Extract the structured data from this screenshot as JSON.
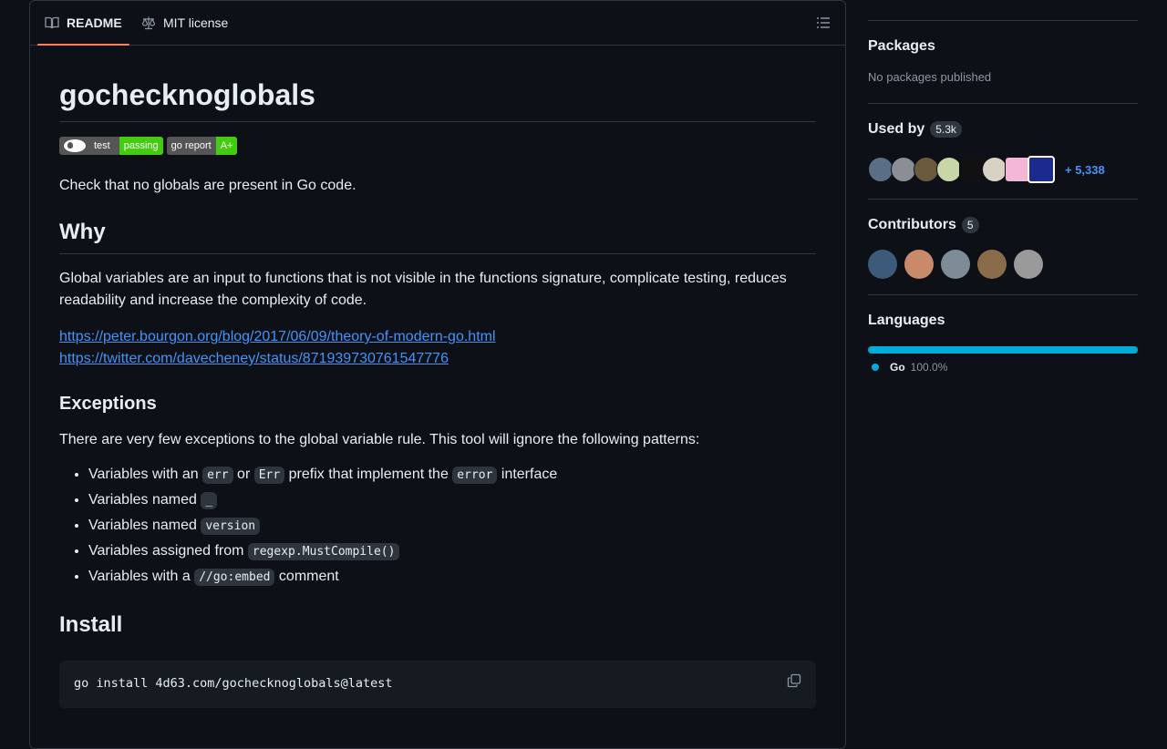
{
  "readme_tabs": {
    "readme_label": "README",
    "license_label": "MIT license"
  },
  "readme": {
    "title": "gochecknoglobals",
    "badges": {
      "test_left": "test",
      "test_right": "passing",
      "report_left": "go report",
      "report_right": "A+"
    },
    "intro": "Check that no globals are present in Go code.",
    "why_heading": "Why",
    "why_text": "Global variables are an input to functions that is not visible in the functions signature, complicate testing, reduces readability and increase the complexity of code.",
    "links": [
      "https://peter.bourgon.org/blog/2017/06/09/theory-of-modern-go.html",
      "https://twitter.com/davecheney/status/871939730761547776"
    ],
    "exceptions_heading": "Exceptions",
    "exceptions_text": "There are very few exceptions to the global variable rule. This tool will ignore the following patterns:",
    "rules": [
      {
        "a": "Variables with an ",
        "c1": "err",
        "b": " or ",
        "c2": "Err",
        "c": " prefix that implement the ",
        "c3": "error",
        "d": " interface"
      },
      {
        "a": "Variables named ",
        "c1": "_"
      },
      {
        "a": "Variables named ",
        "c1": "version"
      },
      {
        "a": "Variables assigned from ",
        "c1": "regexp.MustCompile()"
      },
      {
        "a": "Variables with a ",
        "c1": "//go:embed",
        "b": " comment"
      }
    ],
    "install_heading": "Install",
    "install_cmd": "go install 4d63.com/gochecknoglobals@latest"
  },
  "sidebar": {
    "packages_title": "Packages",
    "packages_text": "No packages published",
    "used_by_title": "Used by",
    "used_by_count": "5.3k",
    "used_by_more": "+ 5,338",
    "contributors_title": "Contributors",
    "contributors_count": "5",
    "languages_title": "Languages",
    "languages": [
      {
        "name": "Go",
        "percent": "100.0%",
        "color": "#00add8"
      }
    ]
  },
  "colors": {
    "background": "#0d1117",
    "border": "#30363d",
    "link": "#4493f8",
    "tab_underline": "#f78166",
    "badge_green": "#44cc11"
  }
}
